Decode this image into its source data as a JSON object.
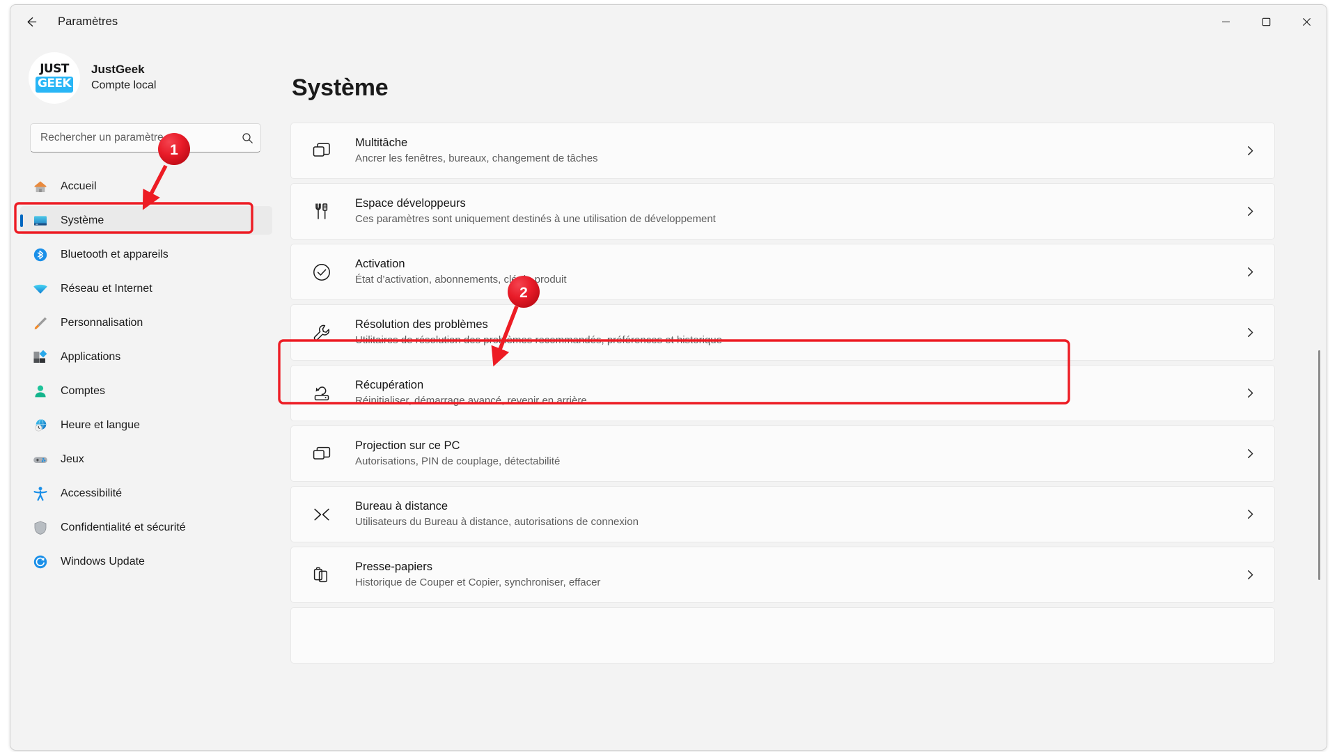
{
  "window": {
    "title": "Paramètres",
    "back_icon": "arrow-left-icon",
    "controls": {
      "minimize": "minimize-icon",
      "maximize": "maximize-icon",
      "close": "close-icon"
    }
  },
  "account": {
    "logo_top": "JUST",
    "logo_bottom": "GEEK",
    "name": "JustGeek",
    "type": "Compte local"
  },
  "search": {
    "placeholder": "Rechercher un paramètre",
    "value": "",
    "icon": "search-icon"
  },
  "sidebar": {
    "items": [
      {
        "label": "Accueil",
        "icon": "home-icon",
        "selected": false
      },
      {
        "label": "Système",
        "icon": "monitor-icon",
        "selected": true
      },
      {
        "label": "Bluetooth et appareils",
        "icon": "bluetooth-icon",
        "selected": false
      },
      {
        "label": "Réseau et Internet",
        "icon": "wifi-icon",
        "selected": false
      },
      {
        "label": "Personnalisation",
        "icon": "paintbrush-icon",
        "selected": false
      },
      {
        "label": "Applications",
        "icon": "apps-icon",
        "selected": false
      },
      {
        "label": "Comptes",
        "icon": "person-icon",
        "selected": false
      },
      {
        "label": "Heure et langue",
        "icon": "globe-clock-icon",
        "selected": false
      },
      {
        "label": "Jeux",
        "icon": "gamepad-icon",
        "selected": false
      },
      {
        "label": "Accessibilité",
        "icon": "accessibility-icon",
        "selected": false
      },
      {
        "label": "Confidentialité et sécurité",
        "icon": "shield-icon",
        "selected": false
      },
      {
        "label": "Windows Update",
        "icon": "update-icon",
        "selected": false
      }
    ]
  },
  "main": {
    "page_title": "Système",
    "cards": [
      {
        "title": "Multitâche",
        "subtitle": "Ancrer les fenêtres, bureaux, changement de tâches",
        "icon": "multitask-icon",
        "chevron": "chevron-right-icon",
        "highlighted": false
      },
      {
        "title": "Espace développeurs",
        "subtitle": "Ces paramètres sont uniquement destinés à une utilisation de développement",
        "icon": "dev-tools-icon",
        "chevron": "chevron-right-icon",
        "highlighted": false
      },
      {
        "title": "Activation",
        "subtitle": "État d’activation, abonnements, clé de produit",
        "icon": "check-circle-icon",
        "chevron": "chevron-right-icon",
        "highlighted": false
      },
      {
        "title": "Résolution des problèmes",
        "subtitle": "Utilitaires de résolution des problèmes recommandés, préférences et historique",
        "icon": "wrench-icon",
        "chevron": "chevron-right-icon",
        "highlighted": false
      },
      {
        "title": "Récupération",
        "subtitle": "Réinitialiser, démarrage avancé, revenir en arrière",
        "icon": "recovery-icon",
        "chevron": "chevron-right-icon",
        "highlighted": true
      },
      {
        "title": "Projection sur ce PC",
        "subtitle": "Autorisations, PIN de couplage, détectabilité",
        "icon": "projection-icon",
        "chevron": "chevron-right-icon",
        "highlighted": false
      },
      {
        "title": "Bureau à distance",
        "subtitle": "Utilisateurs du Bureau à distance, autorisations de connexion",
        "icon": "remote-desktop-icon",
        "chevron": "chevron-right-icon",
        "highlighted": false
      },
      {
        "title": "Presse-papiers",
        "subtitle": "Historique de Couper et Copier, synchroniser, effacer",
        "icon": "clipboard-icon",
        "chevron": "chevron-right-icon",
        "highlighted": false
      }
    ]
  },
  "annotations": {
    "accent_color": "#ed1c24",
    "markers": [
      {
        "label": "1"
      },
      {
        "label": "2"
      }
    ]
  }
}
